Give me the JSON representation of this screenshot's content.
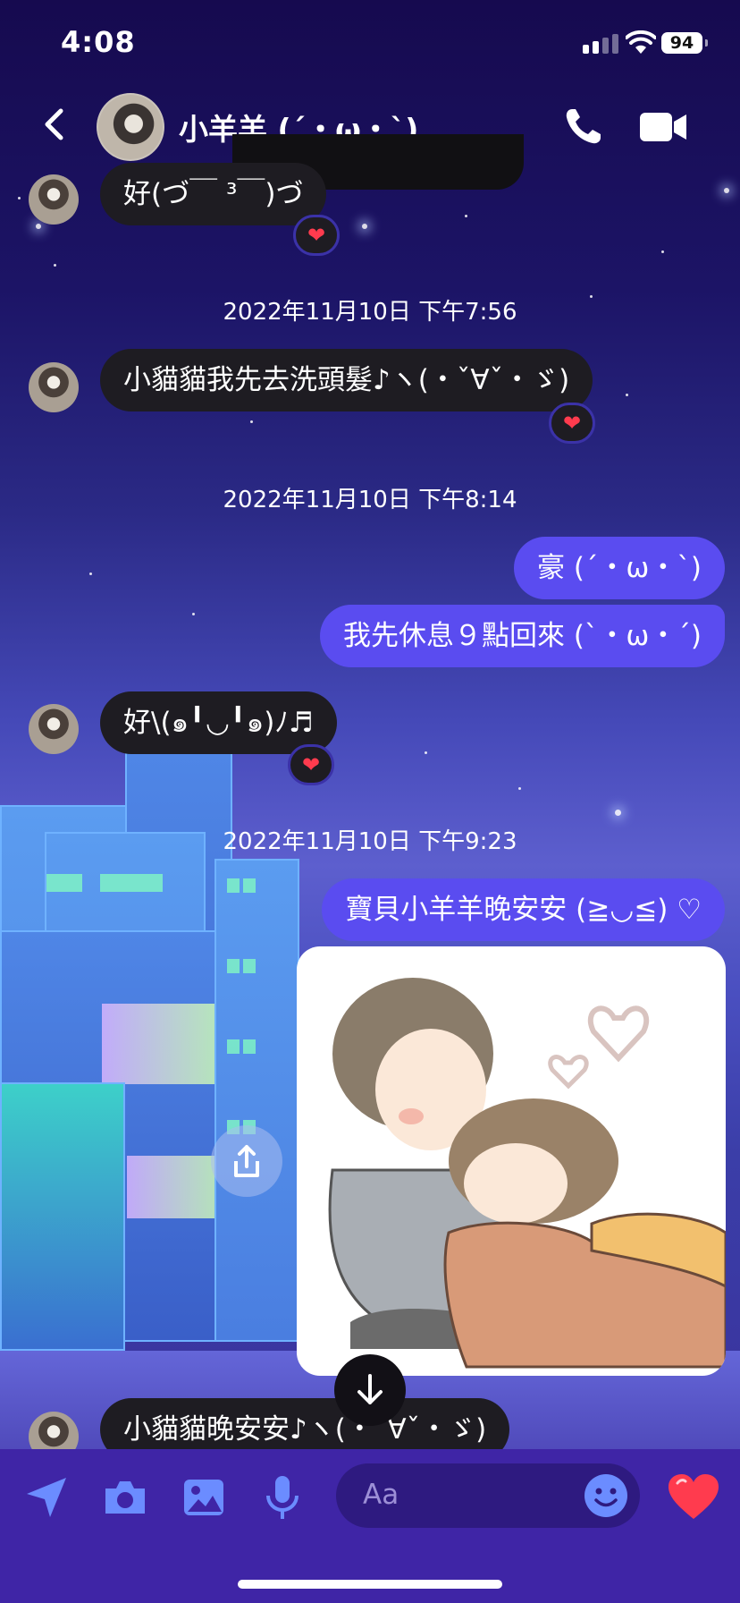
{
  "status": {
    "time": "4:08",
    "battery": "94"
  },
  "header": {
    "contact_name": "小羊羊 (´・ω・`)"
  },
  "messages": [
    {
      "text": "好(づ￣ ³￣)づ",
      "dir": "in"
    },
    {
      "text": "2022年11月10日 下午7:56"
    },
    {
      "text": "小貓貓我先去洗頭髮♪ヽ(・ˇ∀ˇ・ゞ)",
      "dir": "in"
    },
    {
      "text": "2022年11月10日 下午8:14"
    },
    {
      "text": "豪 (´・ω・`)",
      "dir": "out"
    },
    {
      "text": "我先休息９點回來 (`・ω・´)",
      "dir": "out"
    },
    {
      "text": "好\\(๑╹◡╹๑)ﾉ♬",
      "dir": "in"
    },
    {
      "text": "2022年11月10日 下午9:23"
    },
    {
      "text": "寶貝小羊羊晚安安 (≧◡≦) ♡",
      "dir": "out"
    },
    {
      "text": "小貓貓晚安安♪ヽ(・ˇ∀ˇ・ゞ)",
      "dir": "in"
    }
  ],
  "reaction": "❤",
  "composer": {
    "placeholder": "Aa"
  },
  "colors": {
    "incoming": "#1e1c22",
    "outgoing": "#5a4cf0",
    "accent": "#ff3b4e"
  },
  "icons": [
    "back-chevron-icon",
    "phone-icon",
    "video-camera-icon",
    "send-location-icon",
    "camera-icon",
    "image-icon",
    "microphone-icon",
    "emoji-icon",
    "heart-icon",
    "share-icon",
    "arrow-down-icon"
  ]
}
